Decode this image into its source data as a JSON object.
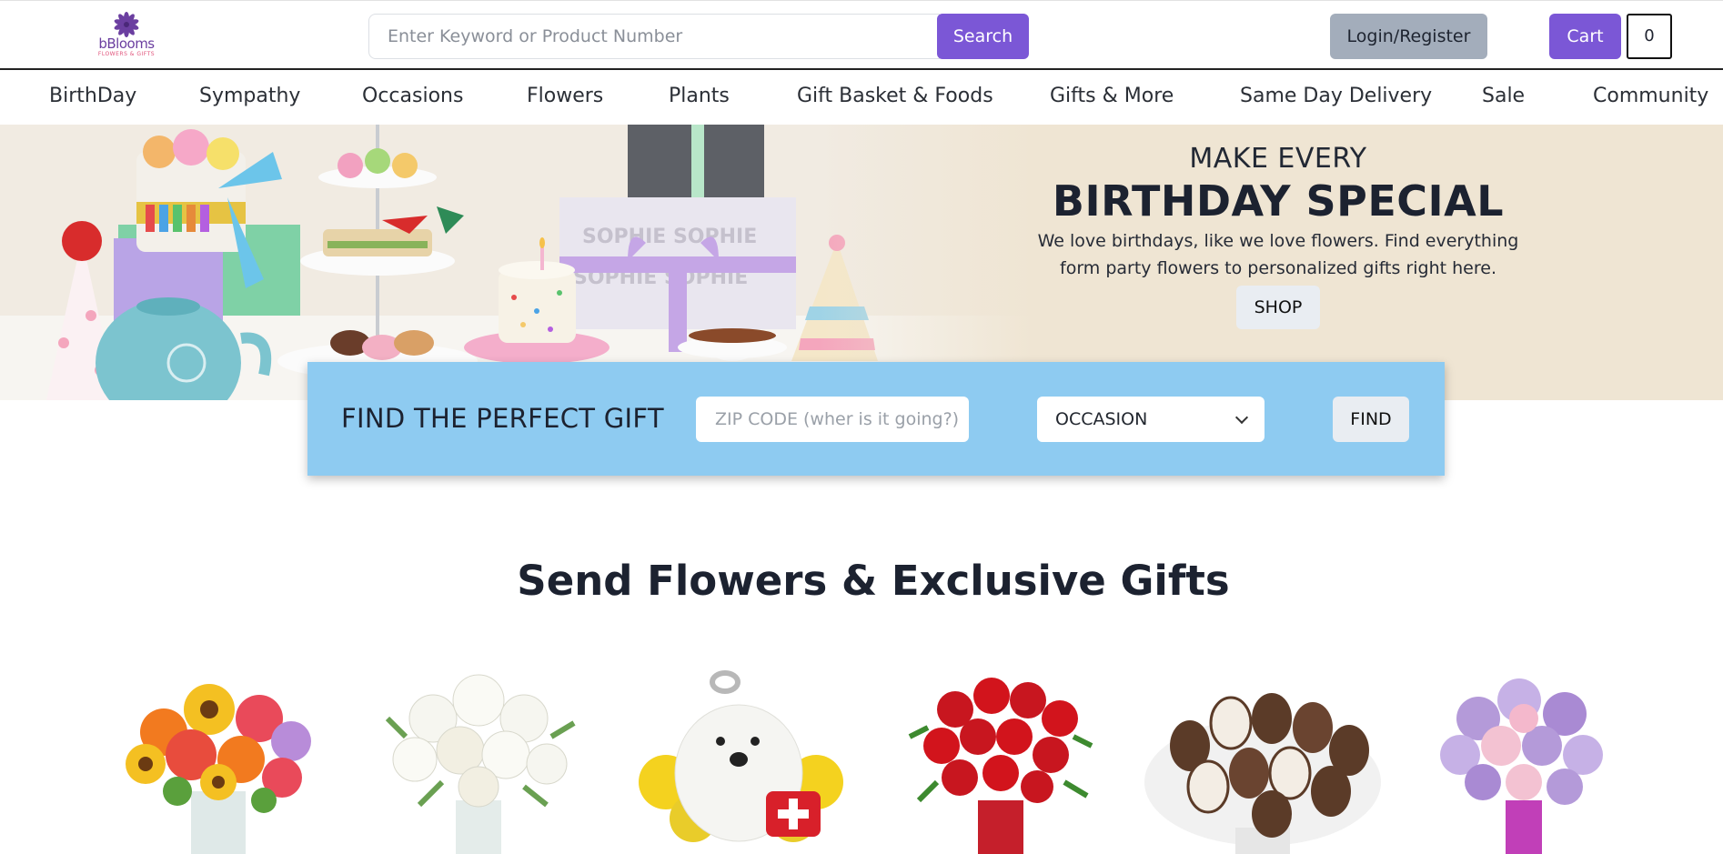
{
  "header": {
    "logo_text": "bBlooms",
    "logo_subtext": "FLOWERS & GIFTS",
    "search_placeholder": "Enter Keyword or Product Number",
    "search_label": "Search",
    "login_label": "Login/Register",
    "cart_label": "Cart",
    "cart_count": "0"
  },
  "nav": {
    "items": [
      "BirthDay",
      "Sympathy",
      "Occasions",
      "Flowers",
      "Plants",
      "Gift Basket & Foods",
      "Gifts & More",
      "Same Day Delivery",
      "Sale",
      "Community"
    ]
  },
  "hero": {
    "line1": "MAKE EVERY",
    "line2": "BIRTHDAY SPECIAL",
    "description": "We love birthdays, like we love flowers. Find everything form party flowers to personalized gifts right here.",
    "shop_label": "SHOP"
  },
  "finder": {
    "title": "FIND THE PERFECT GIFT",
    "zip_placeholder": "ZIP CODE (wher is it going?)",
    "occasion_value": "OCCASION",
    "find_label": "FIND"
  },
  "section": {
    "title": "Send Flowers & Exclusive Gifts"
  },
  "colors": {
    "accent": "#7b57d6",
    "login_bg": "#a3adbb",
    "hero_bg": "#efe5d3",
    "finder_bg": "#8ecbf1"
  },
  "products": [
    {
      "icon": "mixed-sunflower-bouquet"
    },
    {
      "icon": "white-lily-bouquet"
    },
    {
      "icon": "puppy-flower-arrangement"
    },
    {
      "icon": "red-roses-vase"
    },
    {
      "icon": "chocolate-strawberries"
    },
    {
      "icon": "lavender-pink-bouquet"
    }
  ]
}
